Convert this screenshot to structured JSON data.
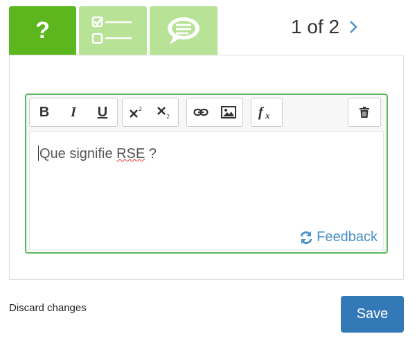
{
  "tabs": {
    "question": {
      "label": "?",
      "icon": "question-mark-icon",
      "active": true,
      "color": "#5cb71e"
    },
    "choices": {
      "icon": "checklist-icon",
      "color": "#b8e296"
    },
    "feedback": {
      "icon": "speech-bubble-icon",
      "color": "#b8e296"
    }
  },
  "pager": {
    "text": "1 of 2",
    "next_icon": "chevron-right-icon"
  },
  "toolbar": {
    "bold": "B",
    "italic": "I",
    "underline": "U",
    "superscript_icon": "superscript-icon",
    "subscript_icon": "subscript-icon",
    "link_icon": "link-icon",
    "image_icon": "image-icon",
    "formula_icon": "formula-fx-icon",
    "delete_icon": "trash-icon"
  },
  "editor": {
    "text_before": "Que signifie ",
    "misspelled": "RSE",
    "text_after": " ?",
    "feedback_label": "Feedback",
    "feedback_icon": "refresh-icon",
    "border_color": "#5cb85c"
  },
  "actions": {
    "discard_label": "Discard changes",
    "save_label": "Save",
    "save_color": "#3379b8"
  }
}
